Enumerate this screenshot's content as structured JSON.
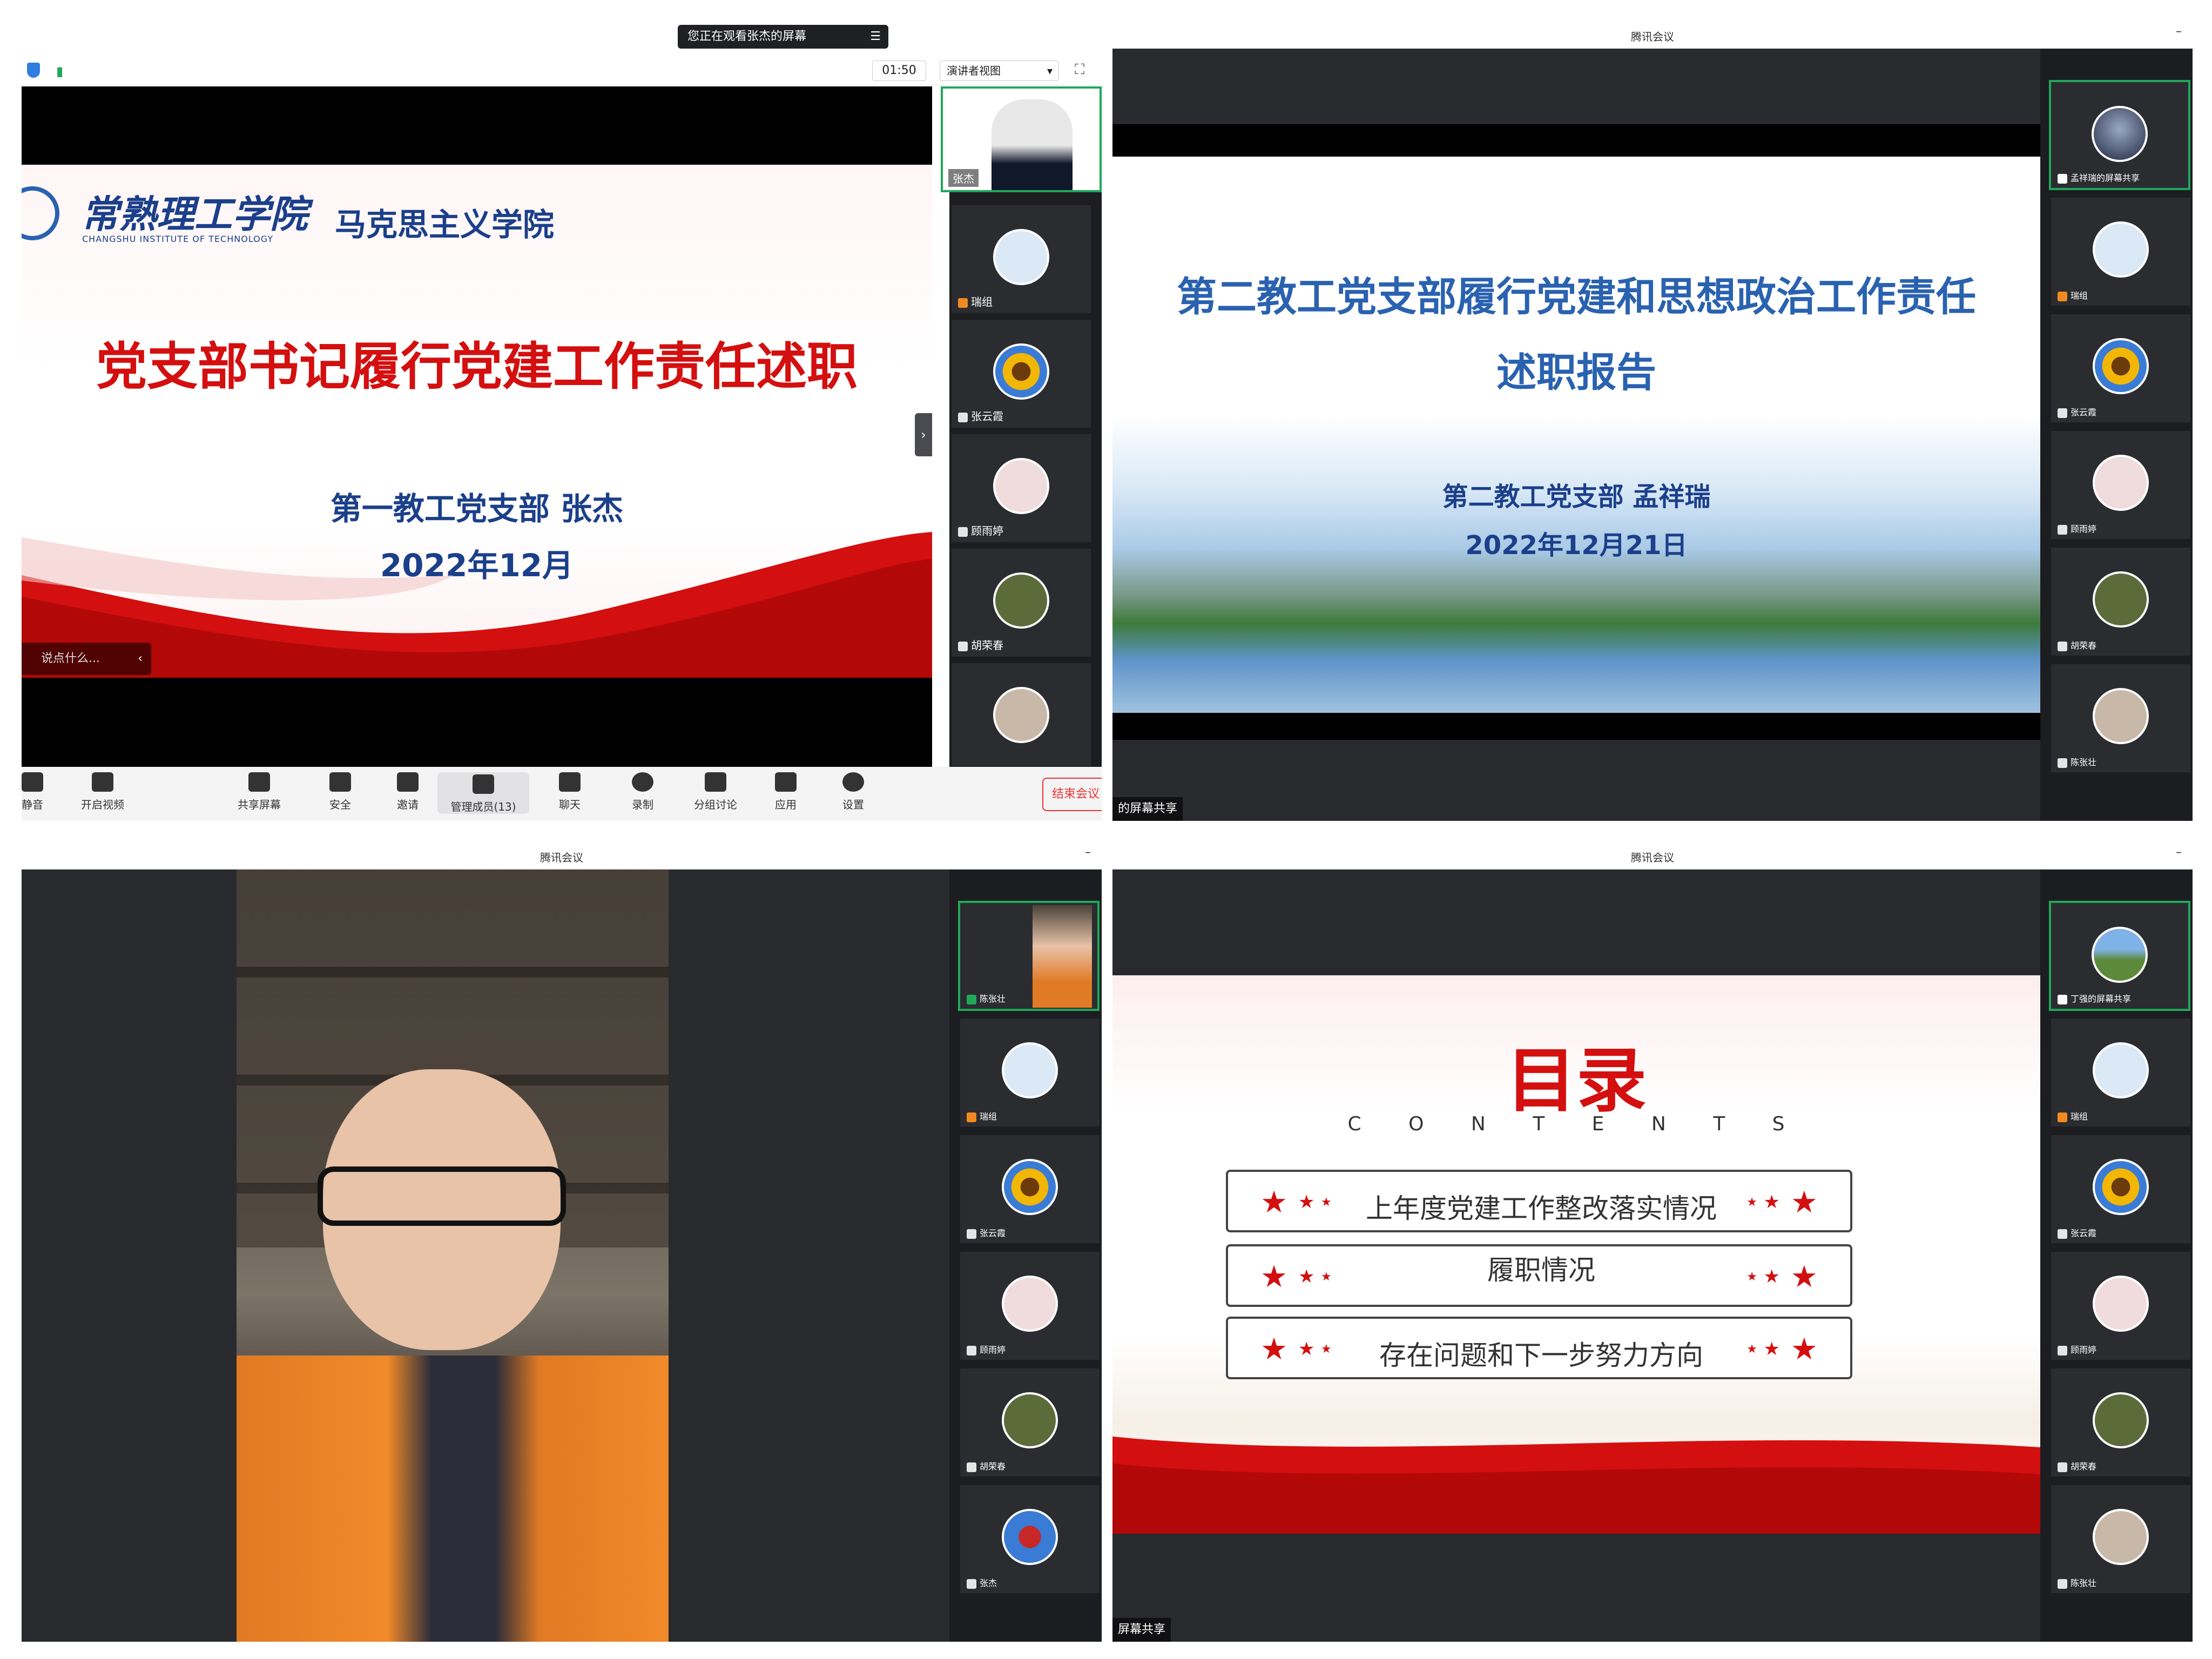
{
  "q1": {
    "banner": "您正在观看张杰的屏幕",
    "timer": "01:50",
    "view_mode": "演讲者视图",
    "slide": {
      "school_cn": "常熟理工学院",
      "school_en": "CHANGSHU INSTITUTE OF TECHNOLOGY",
      "dept": "马克思主义学院",
      "title": "党支部书记履行党建工作责任述职",
      "subtitle": "第一教工党支部 张杰",
      "date": "2022年12月"
    },
    "chat_placeholder": "说点什么...",
    "participants": [
      {
        "name": "张杰"
      },
      {
        "name": "瑞组"
      },
      {
        "name": "张云霞"
      },
      {
        "name": "顾雨婷"
      },
      {
        "name": "胡荣春"
      }
    ],
    "toolbar": {
      "mute": "静音",
      "video": "开启视频",
      "share": "共享屏幕",
      "security": "安全",
      "invite": "邀请",
      "members": "管理成员(13)",
      "chat": "聊天",
      "record": "录制",
      "breakout": "分组讨论",
      "apps": "应用",
      "settings": "设置",
      "end": "结束会议"
    }
  },
  "q2": {
    "app_title": "腾讯会议",
    "slide": {
      "title_line1": "第二教工党支部履行党建和思想政治工作责任",
      "title_line2": "述职报告",
      "subtitle": "第二教工党支部 孟祥瑞",
      "date": "2022年12月21日"
    },
    "share_label": "的屏幕共享",
    "participants": [
      {
        "name": "孟祥瑞的屏幕共享"
      },
      {
        "name": "瑞组"
      },
      {
        "name": "张云霞"
      },
      {
        "name": "顾雨婷"
      },
      {
        "name": "胡荣春"
      },
      {
        "name": "陈张壮"
      }
    ]
  },
  "q3": {
    "app_title": "腾讯会议",
    "participants": [
      {
        "name": "陈张壮"
      },
      {
        "name": "瑞组"
      },
      {
        "name": "张云霞"
      },
      {
        "name": "顾雨婷"
      },
      {
        "name": "胡荣春"
      },
      {
        "name": "张杰"
      }
    ]
  },
  "q4": {
    "app_title": "腾讯会议",
    "slide": {
      "title": "目录",
      "contents": "C O N T E N T S",
      "items": [
        "上年度党建工作整改落实情况",
        "履职情况",
        "存在问题和下一步努力方向"
      ]
    },
    "share_label": "屏幕共享",
    "participants": [
      {
        "name": "丁强的屏幕共享"
      },
      {
        "name": "瑞组"
      },
      {
        "name": "张云霞"
      },
      {
        "name": "顾雨婷"
      },
      {
        "name": "胡荣春"
      },
      {
        "name": "陈张壮"
      }
    ]
  },
  "colors": {
    "party_red": "#d40f0f",
    "slide_blue": "#2a62b0",
    "rail_dark": "#1c1d20",
    "active_green": "#1fa85a"
  }
}
